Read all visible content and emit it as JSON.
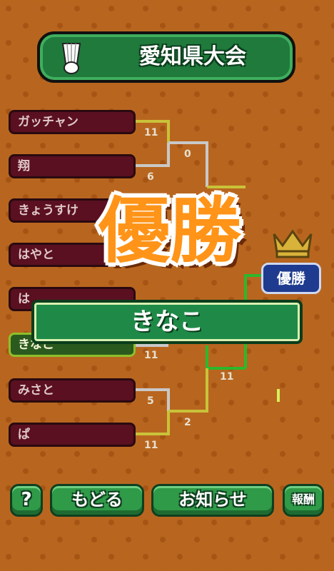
{
  "tournament": {
    "title": "愛知県大会"
  },
  "players": [
    {
      "name": "ガッチャン",
      "winner": false
    },
    {
      "name": "翔",
      "winner": false
    },
    {
      "name": "きょうすけ",
      "winner": false
    },
    {
      "name": "はやと",
      "winner": false
    },
    {
      "name": "は",
      "winner": false
    },
    {
      "name": "きなこ",
      "winner": true
    },
    {
      "name": "みさと",
      "winner": false
    },
    {
      "name": "ぱ",
      "winner": false
    }
  ],
  "scores": {
    "r1_a": "11",
    "r1_b": "6",
    "r2_a": "0",
    "r1_e": "11",
    "r2_c": "11",
    "r1_g": "5",
    "r1_h": "11",
    "r2_d": "2"
  },
  "result": {
    "victory_text": "優勝",
    "champion_badge": "優勝",
    "winner_name": "きなこ"
  },
  "buttons": {
    "help": "?",
    "back": "もどる",
    "news": "お知らせ",
    "reward": "報酬"
  },
  "colors": {
    "background": "#b8661f",
    "bracket_gray": "#c9c9c9",
    "bracket_yellow": "#c9c23a",
    "bracket_green": "#2cb82c",
    "victory_orange": "#ff9418"
  }
}
